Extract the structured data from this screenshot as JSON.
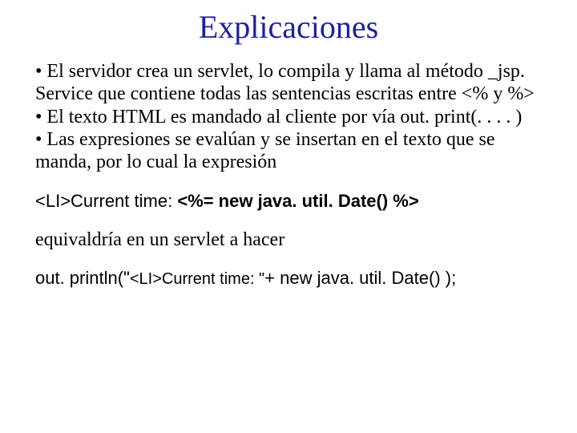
{
  "title": "Explicaciones",
  "bullets": {
    "b1": "El servidor crea un servlet, lo compila y llama al método _jsp. Service  que contiene todas las sentencias escritas entre <% y %>",
    "b2": "El texto HTML es mandado al cliente por vía out. print(. . . . )",
    "b3": "Las expresiones se evalúan y se insertan en el texto que se manda, por lo cual la expresión"
  },
  "code1": {
    "prefix": "<LI>Current time: ",
    "expr": "<%= new java. util. Date() %>"
  },
  "mid": "equivaldría en un servlet a hacer",
  "code2": {
    "p1": "out. println(\"",
    "p2": "<LI>Current time: \"",
    "p3": "+ new java. util. Date() );"
  }
}
